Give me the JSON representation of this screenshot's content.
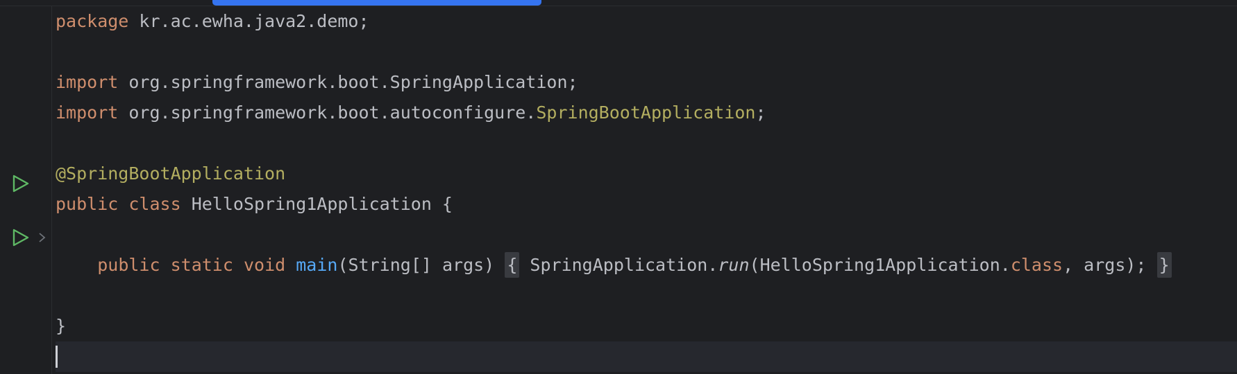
{
  "editor": {
    "scrollbar": {
      "accent": "#3574f0"
    },
    "colors": {
      "background": "#1e1f22",
      "keyword": "#cf8e6d",
      "annotation": "#b3ae60",
      "method": "#56a8f5",
      "text": "#bcbec4",
      "run": "#5fb865"
    },
    "gutter": {
      "run_icon": "run-triangle-icon",
      "fold_icon": "chevron-right-icon"
    },
    "code": {
      "l1_kw": "package",
      "l1_rest": " kr.ac.ewha.java2.demo;",
      "l3_kw": "import",
      "l3_rest": " org.springframework.boot.SpringApplication;",
      "l4_kw": "import",
      "l4_pkg": " org.springframework.boot.autoconfigure.",
      "l4_cls": "SpringBootApplication",
      "l4_end": ";",
      "l6_ann": "@SpringBootApplication",
      "l7_kw1": "public",
      "l7_kw2": "class",
      "l7_rest": " HelloSpring1Application {",
      "l9_kw1": "public",
      "l9_kw2": "static",
      "l9_kw3": "void",
      "l9_fn": "main",
      "l9_params": "(String[] args)",
      "l9_open": "{",
      "l9_body1": " SpringApplication.",
      "l9_run": "run",
      "l9_body2": "(HelloSpring1Application.",
      "l9_class_kw": "class",
      "l9_body3": ", args);",
      "l9_close": "}",
      "l11_brace": "}"
    }
  }
}
